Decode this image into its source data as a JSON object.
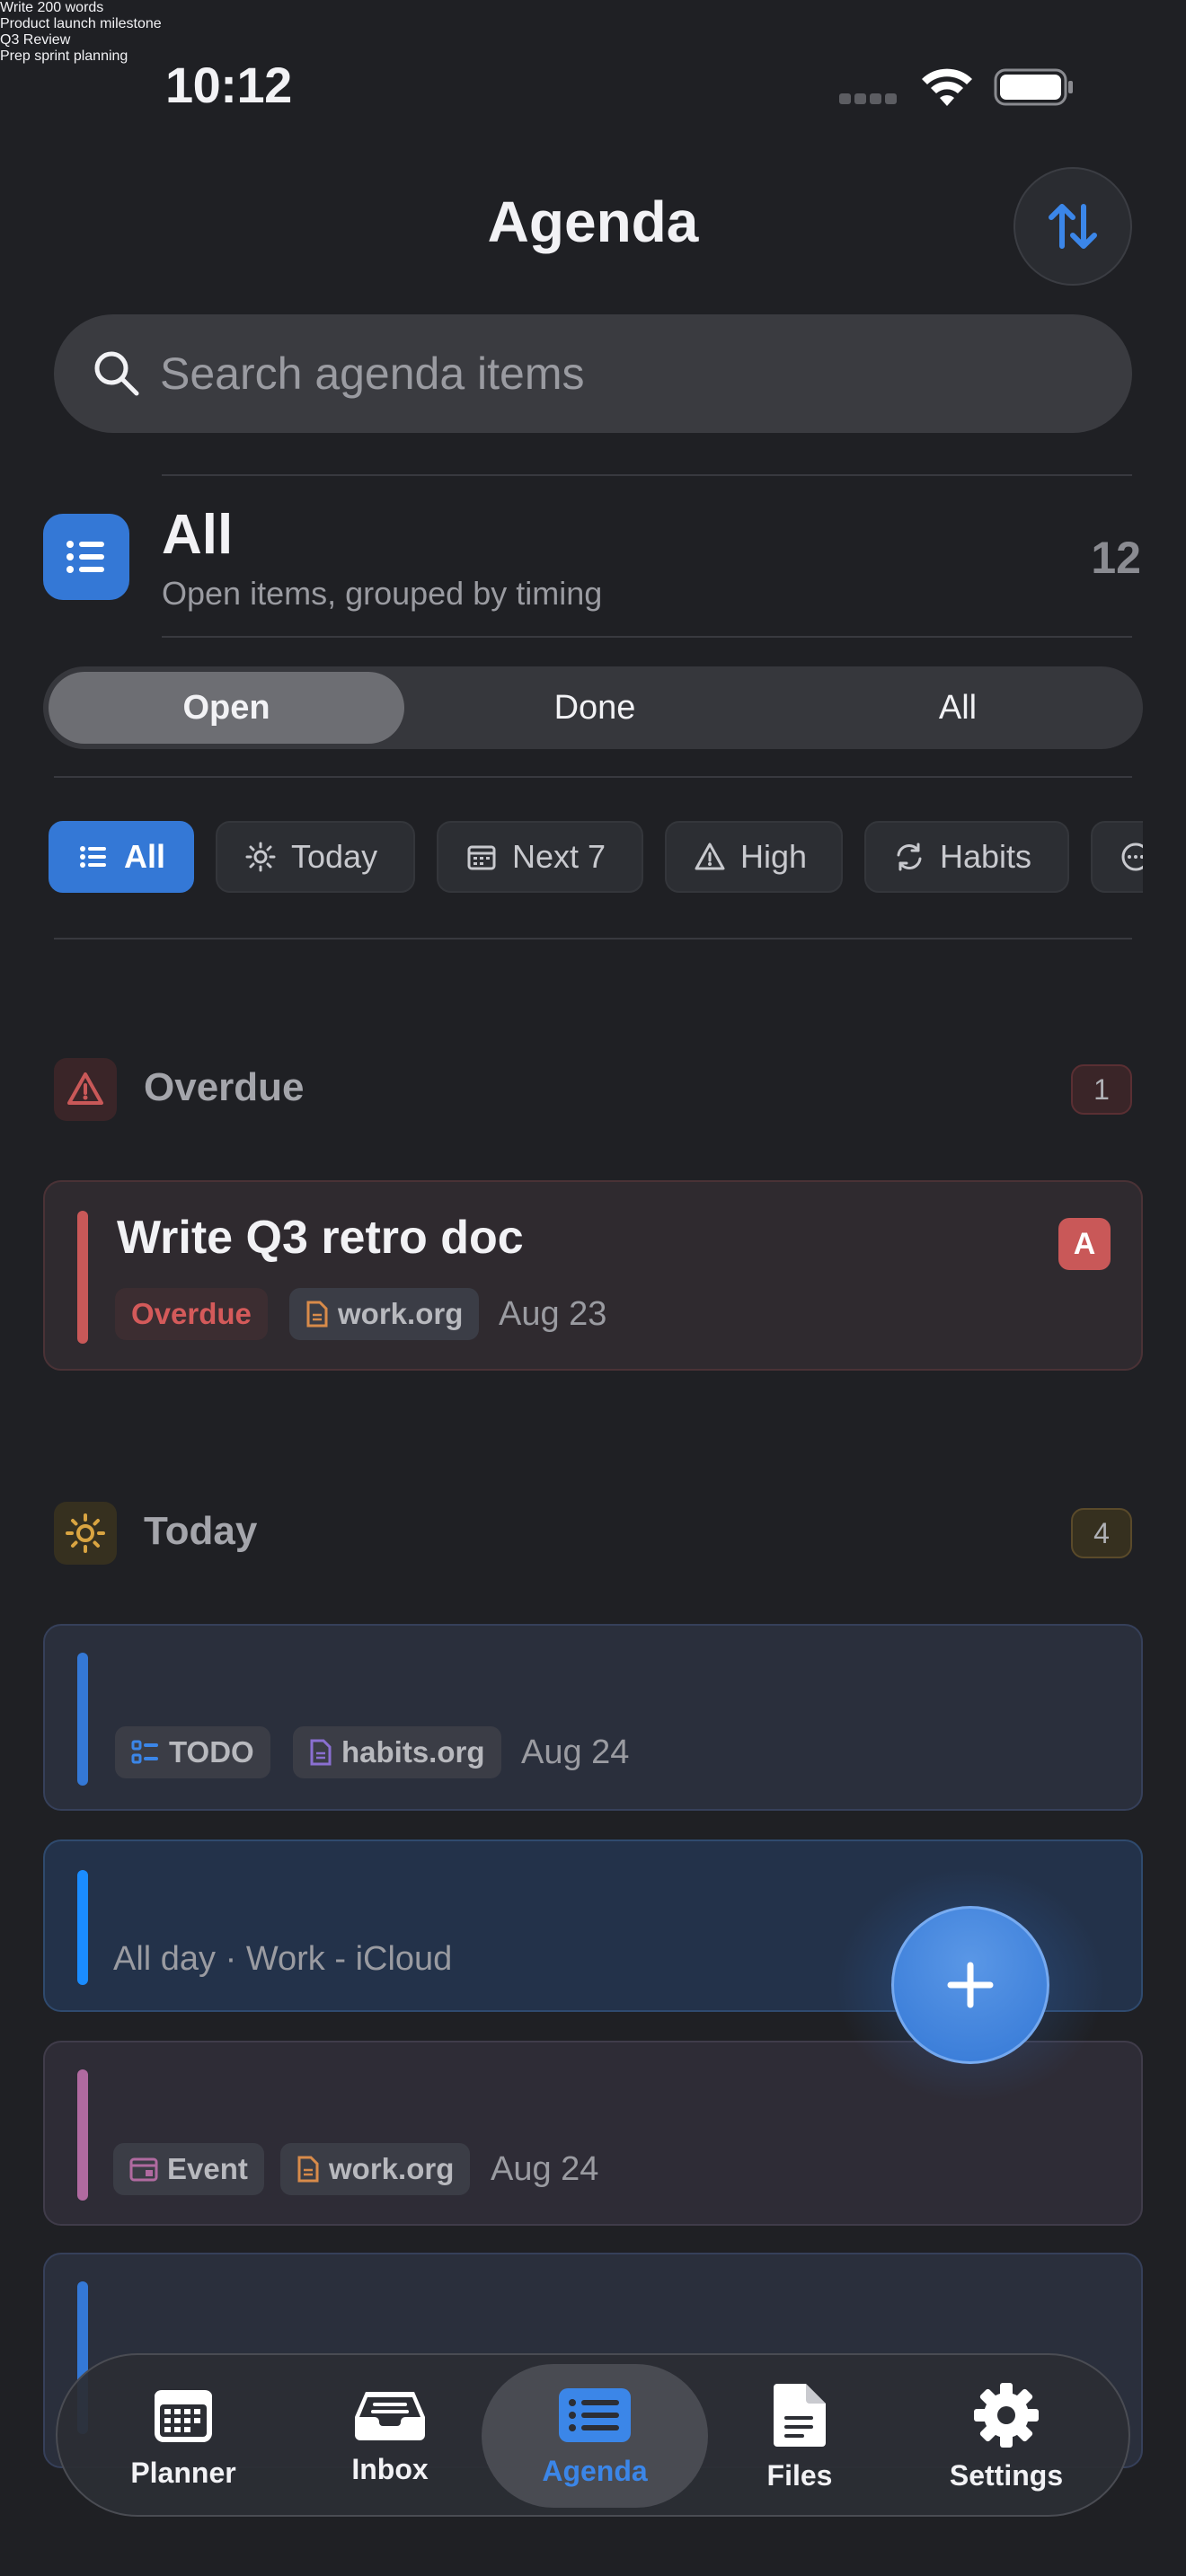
{
  "status_bar": {
    "time": "10:12"
  },
  "header": {
    "title": "Agenda",
    "sort_icon": "sort-arrows-icon"
  },
  "search": {
    "placeholder": "Search agenda items",
    "value": ""
  },
  "filter": {
    "name": "All",
    "description": "Open items, grouped by timing",
    "count": "12"
  },
  "segments": [
    "Open",
    "Done",
    "All"
  ],
  "segments_selected": "Open",
  "chips": [
    {
      "label": "All",
      "icon": "list-icon",
      "active": true
    },
    {
      "label": "Today",
      "icon": "sun-icon",
      "active": false
    },
    {
      "label": "Next 7",
      "icon": "calendar-icon",
      "active": false
    },
    {
      "label": "High",
      "icon": "warning-icon",
      "active": false
    },
    {
      "label": "Habits",
      "icon": "repeat-icon",
      "active": false
    }
  ],
  "sections": {
    "overdue": {
      "title": "Overdue",
      "count": "1",
      "items": [
        {
          "title": "Write Q3 retro doc",
          "status": "Overdue",
          "file": "work.org",
          "date": "Aug 23",
          "priority": "A"
        }
      ]
    },
    "today": {
      "title": "Today",
      "count": "4",
      "items": [
        {
          "title": "Write 200 words",
          "kind": "TODO",
          "file": "habits.org",
          "date": "Aug 24"
        },
        {
          "title": "Product launch milestone",
          "subtitle": "All day · Work - iCloud"
        },
        {
          "title": "Q3 Review",
          "kind": "Event",
          "file": "work.org",
          "date": "Aug 24"
        },
        {
          "title": "Prep sprint planning"
        }
      ]
    }
  },
  "tabs": [
    {
      "label": "Planner",
      "icon": "calendar-grid-icon"
    },
    {
      "label": "Inbox",
      "icon": "inbox-tray-icon"
    },
    {
      "label": "Agenda",
      "icon": "agenda-list-icon"
    },
    {
      "label": "Files",
      "icon": "document-icon"
    },
    {
      "label": "Settings",
      "icon": "gear-icon"
    }
  ],
  "active_tab": "Agenda",
  "colors": {
    "accent": "#3478d6",
    "overdue": "#c95858",
    "today": "#d9a441",
    "habits_file": "#8a6fd1",
    "work_file": "#d88b4a",
    "event": "#b06aa0",
    "calendar_event": "#1a8cff"
  }
}
